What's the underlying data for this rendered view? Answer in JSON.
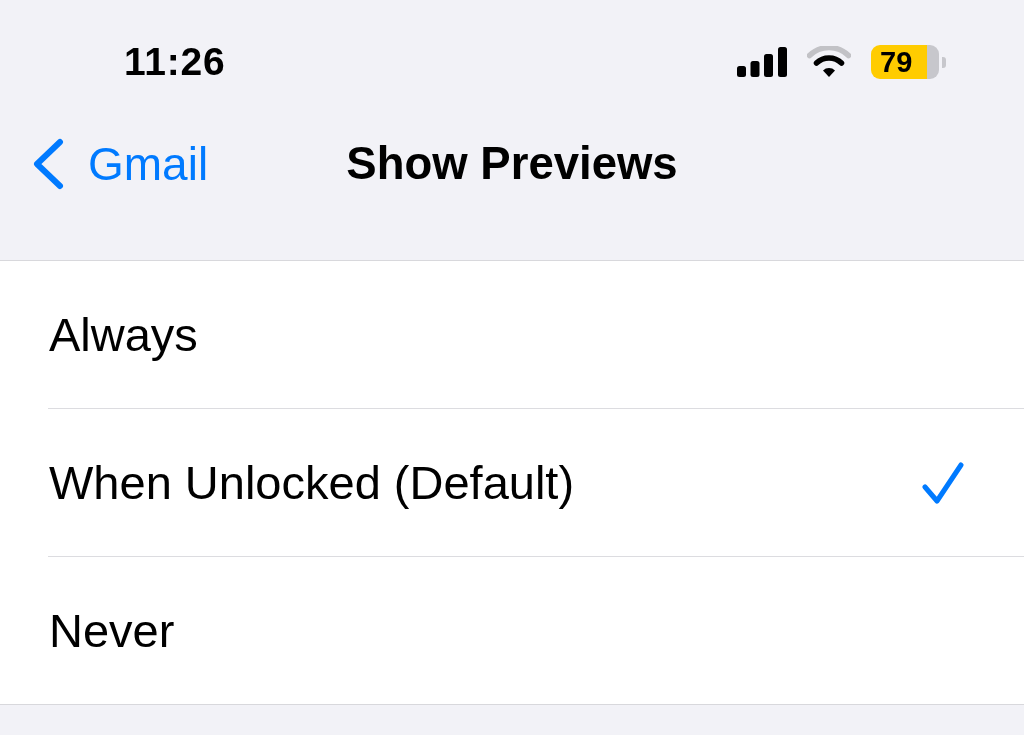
{
  "status_bar": {
    "time": "11:26",
    "battery": {
      "percent": "79",
      "low_power": true
    }
  },
  "nav_bar": {
    "back_label": "Gmail",
    "title": "Show Previews"
  },
  "options": [
    {
      "label": "Always",
      "selected": false
    },
    {
      "label": "When Unlocked (Default)",
      "selected": true
    },
    {
      "label": "Never",
      "selected": false
    }
  ]
}
